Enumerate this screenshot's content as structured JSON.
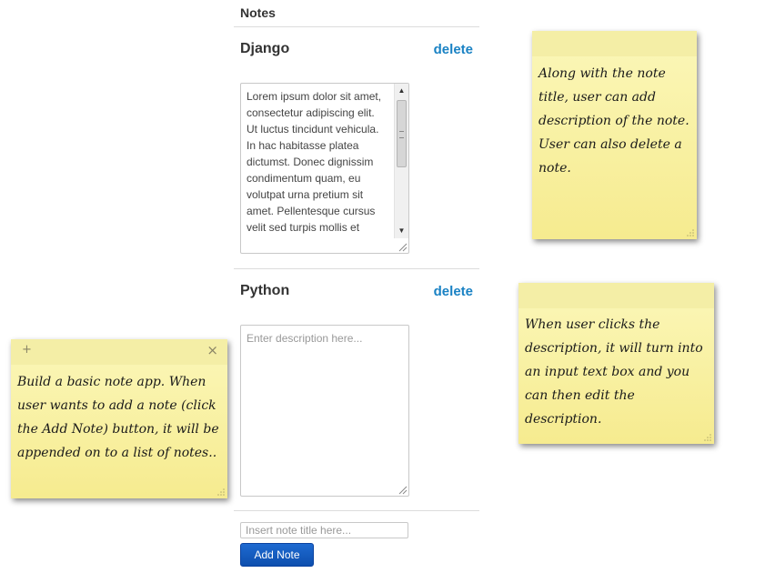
{
  "notes_panel": {
    "title": "Notes",
    "notes": [
      {
        "title": "Django",
        "delete_label": "delete",
        "description": "Lorem ipsum dolor sit amet, consectetur adipiscing elit. Ut luctus tincidunt vehicula. In hac habitasse platea dictumst. Donec dignissim condimentum quam, eu volutpat urna pretium sit amet. Pellentesque cursus velit sed turpis mollis et"
      },
      {
        "title": "Python",
        "delete_label": "delete",
        "description_placeholder": "Enter description here..."
      }
    ],
    "title_input_placeholder": "Insert note title here...",
    "add_button_label": "Add Note"
  },
  "sticky_notes": {
    "left": {
      "add_symbol": "+",
      "close_symbol": "×",
      "text": "Build a basic note app. When user wants to add a note (click the Add Note) button, it will be appended on to a list of notes.."
    },
    "top_right": {
      "text": "Along with the note title, user can add description of the note. User can also delete a note."
    },
    "middle_right": {
      "text": "When user clicks the description, it will turn into an input text box and you can then edit the description."
    }
  },
  "colors": {
    "accent_link": "#1a82c4",
    "button": "#1560c4",
    "sticky": "#f8f0a0"
  }
}
